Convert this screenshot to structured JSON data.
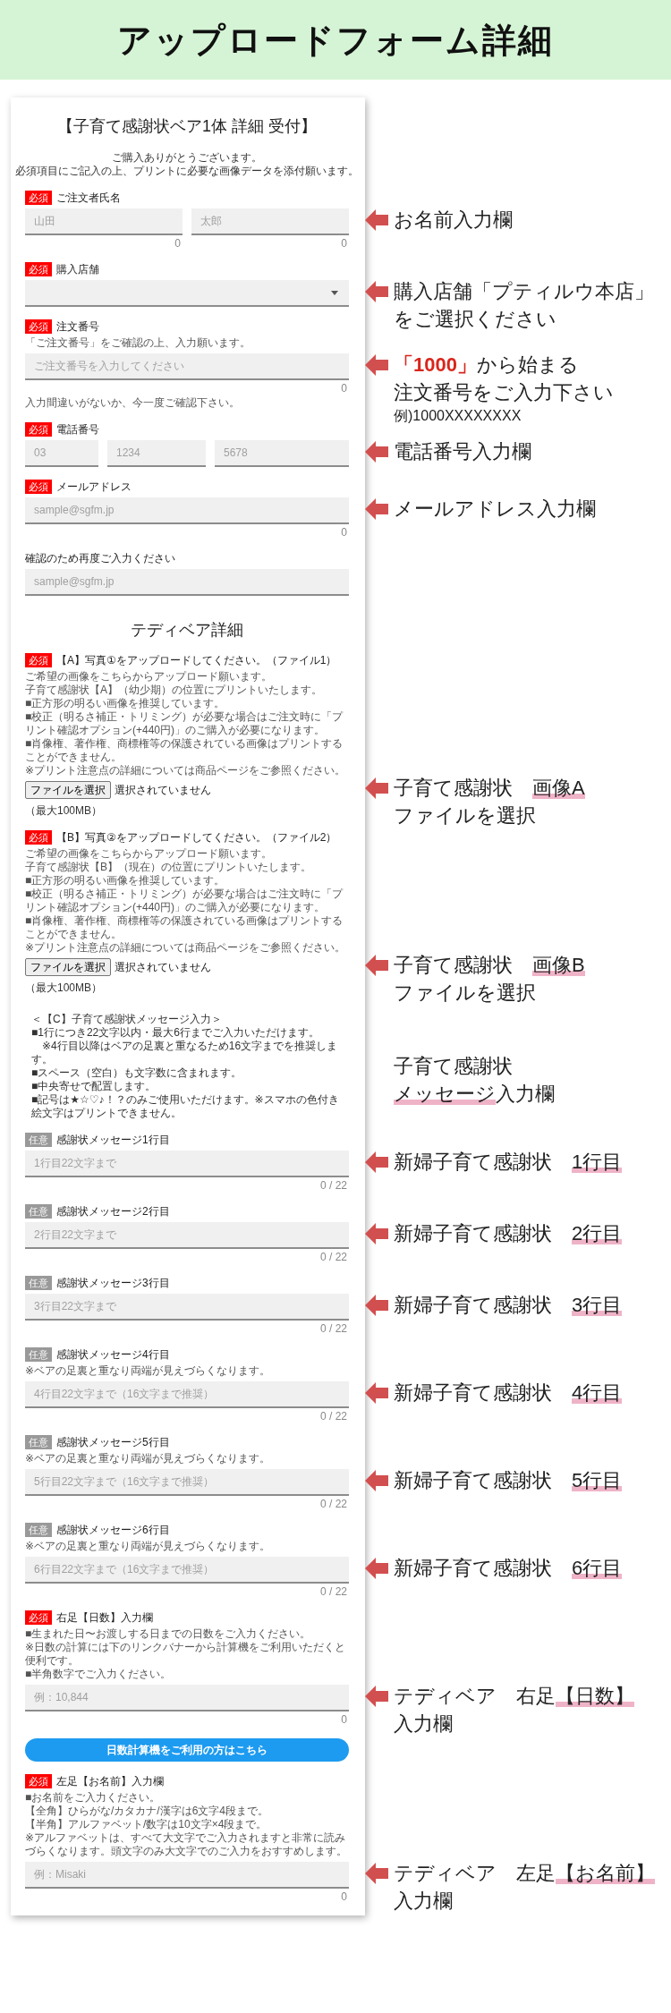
{
  "header": {
    "title": "アップロードフォーム詳細"
  },
  "form": {
    "title": "【子育て感謝状ベア1体 詳細 受付】",
    "intro": [
      "ご購入ありがとうございます。",
      "必須項目にご記入の上、プリントに必要な画像データを添付願います。"
    ],
    "sections": [
      {
        "kind": "input",
        "badge": {
          "text": "必須",
          "required": true
        },
        "label": "ご注文者氏名",
        "inputs": [
          {
            "placeholder": "山田",
            "counter": "0"
          },
          {
            "placeholder": "太郎",
            "counter": "0"
          }
        ],
        "annotation": {
          "arrow": true,
          "lines": [
            {
              "kind": "main",
              "segments": [
                {
                  "kind": "plain",
                  "text": "お名前入力欄"
                }
              ]
            }
          ]
        }
      },
      {
        "kind": "select",
        "badge": {
          "text": "必須",
          "required": true
        },
        "label": "購入店舗",
        "annotation": {
          "arrow": true,
          "lines": [
            {
              "kind": "main",
              "segments": [
                {
                  "kind": "plain",
                  "text": "購入店舗「プティルウ本店」"
                }
              ]
            },
            {
              "kind": "main",
              "segments": [
                {
                  "kind": "plain",
                  "text": "をご選択ください"
                }
              ]
            }
          ]
        }
      },
      {
        "kind": "input",
        "badge": {
          "text": "必須",
          "required": true
        },
        "label": "注文番号",
        "hints": [
          "「ご注文番号」をご確認の上、入力願います。"
        ],
        "inputs": [
          {
            "placeholder": "ご注文番号を入力してください",
            "counter": "0"
          }
        ],
        "notes": [
          "入力間違いがないか、今一度ご確認下さい。"
        ],
        "annotation": {
          "arrow": true,
          "lines": [
            {
              "kind": "main",
              "segments": [
                {
                  "kind": "emphasis",
                  "text": "「1000」"
                },
                {
                  "kind": "plain",
                  "text": "から始まる"
                }
              ]
            },
            {
              "kind": "main",
              "segments": [
                {
                  "kind": "plain",
                  "text": "注文番号をご入力下さい"
                }
              ]
            },
            {
              "kind": "note",
              "segments": [
                {
                  "kind": "plain",
                  "text": "例)1000XXXXXXXX"
                }
              ]
            }
          ]
        }
      },
      {
        "kind": "input",
        "badge": {
          "text": "必須",
          "required": true
        },
        "label": "電話番号",
        "inputs": [
          {
            "placeholder": "03"
          },
          {
            "placeholder": "1234"
          },
          {
            "placeholder": "5678"
          }
        ],
        "annotation": {
          "arrow": true,
          "lines": [
            {
              "kind": "main",
              "segments": [
                {
                  "kind": "plain",
                  "text": "電話番号入力欄"
                }
              ]
            }
          ]
        }
      },
      {
        "kind": "input",
        "badge": {
          "text": "必須",
          "required": true
        },
        "label": "メールアドレス",
        "inputs": [
          {
            "placeholder": "sample@sgfm.jp",
            "counter": "0"
          }
        ],
        "annotation": {
          "arrow": true,
          "lines": [
            {
              "kind": "main",
              "segments": [
                {
                  "kind": "plain",
                  "text": "メールアドレス入力欄"
                }
              ]
            }
          ]
        }
      },
      {
        "kind": "input",
        "label": "確認のため再度ご入力ください",
        "inputs": [
          {
            "placeholder": "sample@sgfm.jp"
          }
        ]
      },
      {
        "kind": "heading",
        "text": "テディベア詳細"
      },
      {
        "kind": "upload",
        "badge": {
          "text": "必須",
          "required": true
        },
        "label": "【A】写真①をアップロードしてください。（ファイル1）",
        "hints": [
          "ご希望の画像をこちらからアップロード願います。",
          "子育て感謝状【A】（幼少期）の位置にプリントいたします。",
          "■正方形の明るい画像を推奨しています。",
          "■校正（明るさ補正・トリミング）が必要な場合はご注文時に「プリント確認オプション(+440円)」のご購入が必要になります。",
          "■肖像権、著作権、商標権等の保護されている画像はプリントすることができません。",
          "※プリント注意点の詳細については商品ページをご参照ください。"
        ],
        "file_button": "ファイルを選択",
        "file_status": "選択されていません",
        "limit": "（最大100MB）",
        "annotation": {
          "arrow": true,
          "lines": [
            {
              "kind": "main",
              "segments": [
                {
                  "kind": "plain",
                  "text": "子育て感謝状　"
                },
                {
                  "kind": "marker",
                  "text": "画像A"
                }
              ]
            },
            {
              "kind": "main",
              "segments": [
                {
                  "kind": "plain",
                  "text": "ファイルを選択"
                }
              ]
            }
          ]
        }
      },
      {
        "kind": "upload",
        "badge": {
          "text": "必須",
          "required": true
        },
        "label": "【B】写真②をアップロードしてください。（ファイル2）",
        "hints": [
          "ご希望の画像をこちらからアップロード願います。",
          "子育て感謝状【B】（現在）の位置にプリントいたします。",
          "■正方形の明るい画像を推奨しています。",
          "■校正（明るさ補正・トリミング）が必要な場合はご注文時に「プリント確認オプション(+440円)」のご購入が必要になります。",
          "■肖像権、著作権、商標権等の保護されている画像はプリントすることができません。",
          "※プリント注意点の詳細については商品ページをご参照ください。"
        ],
        "file_button": "ファイルを選択",
        "file_status": "選択されていません",
        "limit": "（最大100MB）",
        "annotation": {
          "arrow": true,
          "lines": [
            {
              "kind": "main",
              "segments": [
                {
                  "kind": "plain",
                  "text": "子育て感謝状　"
                },
                {
                  "kind": "marker",
                  "text": "画像B"
                }
              ]
            },
            {
              "kind": "main",
              "segments": [
                {
                  "kind": "plain",
                  "text": "ファイルを選択"
                }
              ]
            }
          ]
        }
      },
      {
        "kind": "notice",
        "lines": [
          "＜【C】子育て感謝状メッセージ入力＞",
          "■1行につき22文字以内・最大6行までご入力いただけます。",
          "　※4行目以降はベアの足裏と重なるため16文字までを推奨します。",
          "■スペース（空白）も文字数に含まれます。",
          "■中央寄せで配置します。",
          "■記号は★☆♡♪！？のみご使用いただけます。※スマホの色付き絵文字はプリントできません。"
        ],
        "annotation": {
          "arrow": false,
          "lines": [
            {
              "kind": "main",
              "segments": [
                {
                  "kind": "plain",
                  "text": "子育て感謝状"
                }
              ]
            },
            {
              "kind": "main",
              "segments": [
                {
                  "kind": "marker",
                  "text": "メッセージ"
                },
                {
                  "kind": "plain",
                  "text": "入力欄"
                }
              ]
            }
          ]
        }
      },
      {
        "kind": "input",
        "badge": {
          "text": "任意",
          "required": false
        },
        "label": "感謝状メッセージ1行目",
        "inputs": [
          {
            "placeholder": "1行目22文字まで",
            "counter": "0 / 22"
          }
        ],
        "annotation": {
          "arrow": true,
          "lines": [
            {
              "kind": "main",
              "segments": [
                {
                  "kind": "plain",
                  "text": "新婦子育て感謝状　"
                },
                {
                  "kind": "marker",
                  "text": "1行目"
                }
              ]
            }
          ]
        }
      },
      {
        "kind": "input",
        "badge": {
          "text": "任意",
          "required": false
        },
        "label": "感謝状メッセージ2行目",
        "inputs": [
          {
            "placeholder": "2行目22文字まで",
            "counter": "0 / 22"
          }
        ],
        "annotation": {
          "arrow": true,
          "lines": [
            {
              "kind": "main",
              "segments": [
                {
                  "kind": "plain",
                  "text": "新婦子育て感謝状　"
                },
                {
                  "kind": "marker",
                  "text": "2行目"
                }
              ]
            }
          ]
        }
      },
      {
        "kind": "input",
        "badge": {
          "text": "任意",
          "required": false
        },
        "label": "感謝状メッセージ3行目",
        "inputs": [
          {
            "placeholder": "3行目22文字まで",
            "counter": "0 / 22"
          }
        ],
        "annotation": {
          "arrow": true,
          "lines": [
            {
              "kind": "main",
              "segments": [
                {
                  "kind": "plain",
                  "text": "新婦子育て感謝状　"
                },
                {
                  "kind": "marker",
                  "text": "3行目"
                }
              ]
            }
          ]
        }
      },
      {
        "kind": "input",
        "badge": {
          "text": "任意",
          "required": false
        },
        "label": "感謝状メッセージ4行目",
        "hints": [
          "※ベアの足裏と重なり両端が見えづらくなります。"
        ],
        "inputs": [
          {
            "placeholder": "4行目22文字まで（16文字まで推奨）",
            "counter": "0 / 22"
          }
        ],
        "annotation": {
          "arrow": true,
          "lines": [
            {
              "kind": "main",
              "segments": [
                {
                  "kind": "plain",
                  "text": "新婦子育て感謝状　"
                },
                {
                  "kind": "marker",
                  "text": "4行目"
                }
              ]
            }
          ]
        }
      },
      {
        "kind": "input",
        "badge": {
          "text": "任意",
          "required": false
        },
        "label": "感謝状メッセージ5行目",
        "hints": [
          "※ベアの足裏と重なり両端が見えづらくなります。"
        ],
        "inputs": [
          {
            "placeholder": "5行目22文字まで（16文字まで推奨）",
            "counter": "0 / 22"
          }
        ],
        "annotation": {
          "arrow": true,
          "lines": [
            {
              "kind": "main",
              "segments": [
                {
                  "kind": "plain",
                  "text": "新婦子育て感謝状　"
                },
                {
                  "kind": "marker",
                  "text": "5行目"
                }
              ]
            }
          ]
        }
      },
      {
        "kind": "input",
        "badge": {
          "text": "任意",
          "required": false
        },
        "label": "感謝状メッセージ6行目",
        "hints": [
          "※ベアの足裏と重なり両端が見えづらくなります。"
        ],
        "inputs": [
          {
            "placeholder": "6行目22文字まで（16文字まで推奨）",
            "counter": "0 / 22"
          }
        ],
        "annotation": {
          "arrow": true,
          "lines": [
            {
              "kind": "main",
              "segments": [
                {
                  "kind": "plain",
                  "text": "新婦子育て感謝状　"
                },
                {
                  "kind": "marker",
                  "text": "6行目"
                }
              ]
            }
          ]
        }
      },
      {
        "kind": "input",
        "badge": {
          "text": "必須",
          "required": true
        },
        "label": "右足【日数】入力欄",
        "hints": [
          "■生まれた日〜お渡しする日までの日数をご入力ください。",
          "※日数の計算には下のリンクバナーから計算機をご利用いただくと便利です。",
          "■半角数字でご入力ください。"
        ],
        "inputs": [
          {
            "placeholder": "例：10,844",
            "counter": "0"
          }
        ],
        "annotation": {
          "arrow": true,
          "lines": [
            {
              "kind": "main",
              "segments": [
                {
                  "kind": "plain",
                  "text": "テディベア　右足"
                },
                {
                  "kind": "marker",
                  "text": "【日数】"
                }
              ]
            },
            {
              "kind": "main",
              "segments": [
                {
                  "kind": "plain",
                  "text": "入力欄"
                }
              ]
            }
          ]
        }
      },
      {
        "kind": "button",
        "label": "日数計算機をご利用の方はこちら"
      },
      {
        "kind": "input",
        "badge": {
          "text": "必須",
          "required": true
        },
        "label": "左足【お名前】入力欄",
        "hints": [
          "■お名前をご入力ください。",
          "【全角】ひらがな/カタカナ/漢字は6文字4段まで。",
          "【半角】アルファベット/数字は10文字×4段まで。",
          "※アルファベットは、すべて大文字でご入力されますと非常に読みづらくなります。頭文字のみ大文字でのご入力をおすすめします。"
        ],
        "inputs": [
          {
            "placeholder": "例：Misaki",
            "counter": "0"
          }
        ],
        "annotation": {
          "arrow": true,
          "lines": [
            {
              "kind": "main",
              "segments": [
                {
                  "kind": "plain",
                  "text": "テディベア　左足"
                },
                {
                  "kind": "marker",
                  "text": "【お名前】"
                }
              ]
            },
            {
              "kind": "main",
              "segments": [
                {
                  "kind": "plain",
                  "text": "入力欄"
                }
              ]
            }
          ]
        }
      }
    ]
  }
}
